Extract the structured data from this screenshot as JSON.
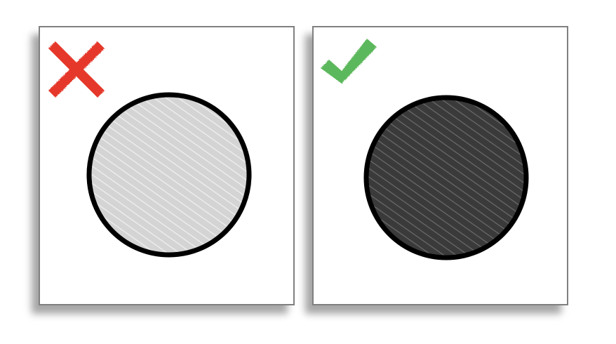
{
  "panels": [
    {
      "id": "wrong",
      "verdict_icon": "cross-icon",
      "icon_color": "#e5392a",
      "circle_fill": "#d6d6d6",
      "circle_stroke": "#000000"
    },
    {
      "id": "right",
      "verdict_icon": "checkmark-icon",
      "icon_color": "#5cb85c",
      "circle_fill": "#3d3d3d",
      "circle_stroke": "#000000"
    }
  ]
}
